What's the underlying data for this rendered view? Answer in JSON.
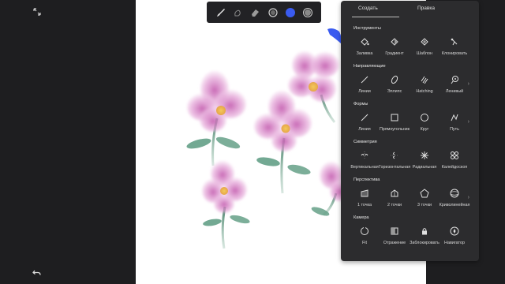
{
  "panel": {
    "tabs": [
      {
        "label": "Создать"
      },
      {
        "label": "Правка"
      }
    ],
    "sections": [
      {
        "title": "Инструменты",
        "items": [
          {
            "label": "Заливка",
            "icon": "fill-icon"
          },
          {
            "label": "Градиент",
            "icon": "gradient-icon"
          },
          {
            "label": "Шаблон",
            "icon": "pattern-icon"
          },
          {
            "label": "Клонировать",
            "icon": "clone-stamp-icon"
          }
        ]
      },
      {
        "title": "Направляющие",
        "items": [
          {
            "label": "Линии",
            "icon": "line-guide-icon"
          },
          {
            "label": "Эллипс",
            "icon": "ellipse-guide-icon"
          },
          {
            "label": "Hatching",
            "icon": "hatching-icon"
          },
          {
            "label": "Ленивый",
            "icon": "lazy-icon"
          }
        ]
      },
      {
        "title": "Формы",
        "items": [
          {
            "label": "Линия",
            "icon": "line-shape-icon"
          },
          {
            "label": "Прямоугольник",
            "icon": "rectangle-icon"
          },
          {
            "label": "Круг",
            "icon": "circle-icon"
          },
          {
            "label": "Путь",
            "icon": "path-icon"
          }
        ]
      },
      {
        "title": "Симметрия",
        "items": [
          {
            "label": "Вертикальная",
            "icon": "vertical-symmetry-icon"
          },
          {
            "label": "Горизонтальная",
            "icon": "horizontal-symmetry-icon"
          },
          {
            "label": "Радиальная",
            "icon": "radial-symmetry-icon"
          },
          {
            "label": "Калейдоскоп",
            "icon": "kaleidoscope-icon"
          }
        ]
      },
      {
        "title": "Перспектива",
        "items": [
          {
            "label": "1 точка",
            "icon": "one-point-perspective-icon"
          },
          {
            "label": "2 точки",
            "icon": "two-point-perspective-icon"
          },
          {
            "label": "3 точки",
            "icon": "three-point-perspective-icon"
          },
          {
            "label": "Криволинейная",
            "icon": "curvilinear-icon"
          }
        ]
      },
      {
        "title": "Камера",
        "items": [
          {
            "label": "Fit",
            "icon": "fit-icon"
          },
          {
            "label": "Отражение",
            "icon": "mirror-icon"
          },
          {
            "label": "Заблокировать",
            "icon": "lock-icon"
          },
          {
            "label": "Навигатор",
            "icon": "navigator-icon"
          }
        ]
      }
    ]
  },
  "toolbar": {
    "tools": [
      "brush-icon",
      "smudge-icon",
      "eraser-icon",
      "brush-size-icon",
      "color-swatch-icon",
      "opacity-icon"
    ]
  },
  "colors": {
    "accent_blue": "#3a5bf0",
    "panel_bg": "#2c2c2e",
    "flower_pink": "#d97fc7",
    "flower_center": "#e8b24a",
    "stem_green": "#4f8f76"
  }
}
